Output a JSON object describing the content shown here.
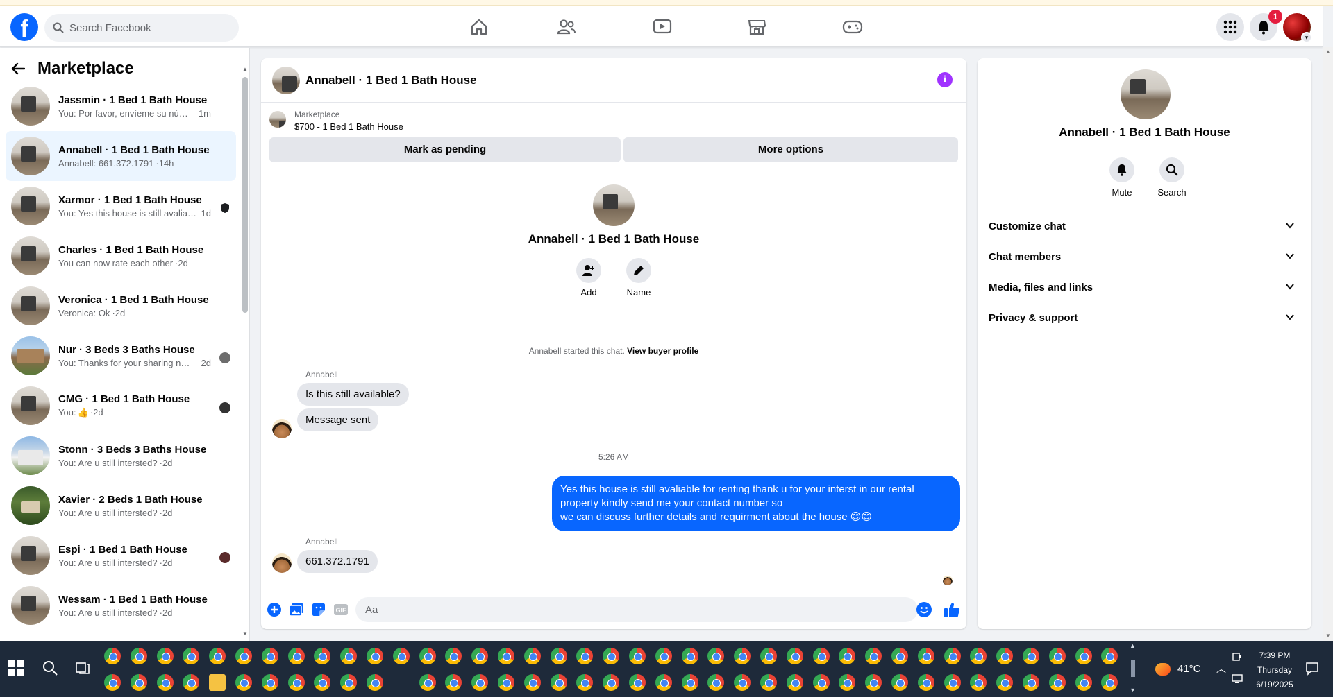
{
  "header": {
    "logo_letter": "f",
    "search_placeholder": "Search Facebook",
    "nav": [
      "home-icon",
      "friends-icon",
      "watch-icon",
      "marketplace-icon",
      "gaming-icon"
    ],
    "right": [
      "menu-grid-icon",
      "bell-icon"
    ],
    "notification_count": "1"
  },
  "left": {
    "title": "Marketplace",
    "conversations": [
      {
        "name": "Jassmin · 1 Bed 1 Bath House",
        "preview": "You: Por favor, envíeme su número...",
        "time": "1m"
      },
      {
        "name": "Annabell · 1 Bed 1 Bath House",
        "preview": "Annabell: 661.372.1791",
        "time": "14h",
        "active": true
      },
      {
        "name": "Xarmor · 1 Bed 1 Bath House",
        "preview": "You: Yes this house is still avaliab...",
        "time": "1d"
      },
      {
        "name": "Charles · 1 Bed 1 Bath House",
        "preview": "You can now rate each other",
        "time": "2d"
      },
      {
        "name": "Veronica · 1 Bed 1 Bath House",
        "preview": "Veronica: Ok",
        "time": "2d"
      },
      {
        "name": "Nur · 3 Beds 3 Baths House",
        "preview": "You: Thanks for your sharing nu...",
        "time": "2d"
      },
      {
        "name": "CMG · 1 Bed 1 Bath House",
        "preview": "You: ",
        "time": "2d"
      },
      {
        "name": "Stonn · 3 Beds 3 Baths House",
        "preview": "You: Are u still intersted?",
        "time": "2d"
      },
      {
        "name": "Xavier · 2 Beds 1 Bath House",
        "preview": "You: Are u still intersted?",
        "time": "2d"
      },
      {
        "name": "Espi · 1 Bed 1 Bath House",
        "preview": "You: Are u still intersted?",
        "time": "2d"
      },
      {
        "name": "Wessam · 1 Bed 1 Bath House",
        "preview": "You: Are u still intersted?",
        "time": "2d"
      }
    ]
  },
  "chat": {
    "title": "Annabell · 1 Bed 1 Bath House",
    "info_glyph": "i",
    "marketplace_label": "Marketplace",
    "listing": "$700 - 1 Bed 1 Bath House",
    "btn_pending": "Mark as pending",
    "btn_more": "More options",
    "hero_title": "Annabell · 1 Bed 1 Bath House",
    "action_add": "Add",
    "action_name": "Name",
    "started_text": "Annabell started this chat.",
    "started_link": "View buyer profile",
    "sender": "Annabell",
    "msg1": "Is this still available?",
    "msg2": "Message sent",
    "timestamp": "5:26 AM",
    "out_line1": "Yes this house is still avaliable for renting thank u for your interst in our rental",
    "out_line2": "property kindly send me your contact number so",
    "out_line3": "we can discuss further details and requirment about the house 😊😊",
    "sender2": "Annabell",
    "msg3": "661.372.1791",
    "composer_placeholder": "Aa"
  },
  "right": {
    "title": "Annabell · 1 Bed 1 Bath House",
    "mute": "Mute",
    "search": "Search",
    "sections": [
      "Customize chat",
      "Chat members",
      "Media, files and links",
      "Privacy & support"
    ]
  },
  "taskbar": {
    "temp": "41°C",
    "time": "7:39 PM",
    "day": "Thursday",
    "date": "6/19/2025"
  }
}
